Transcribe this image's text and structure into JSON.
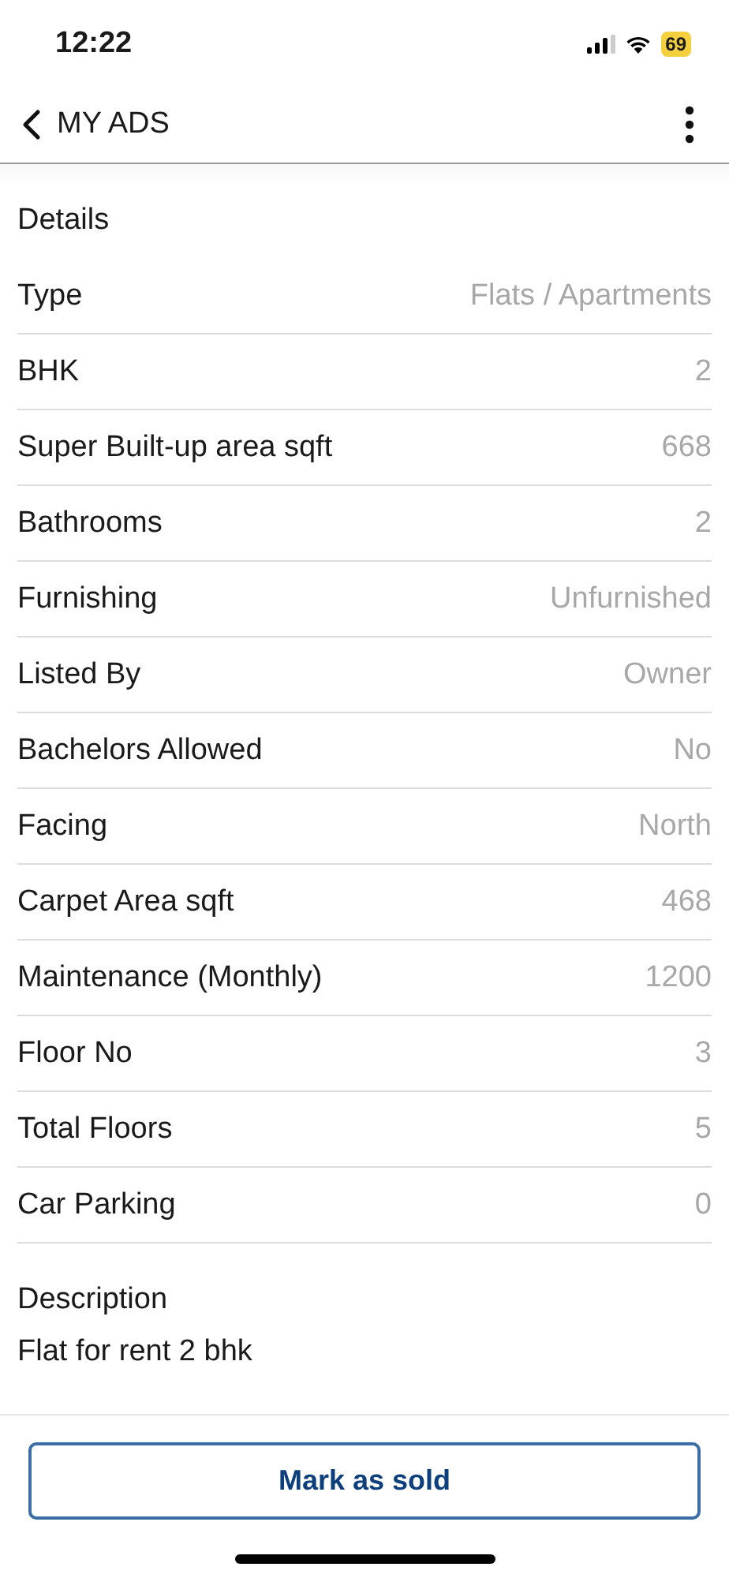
{
  "status_bar": {
    "time": "12:22",
    "battery": "69"
  },
  "header": {
    "title": "MY ADS"
  },
  "details": {
    "heading": "Details",
    "rows": [
      {
        "label": "Type",
        "value": "Flats / Apartments"
      },
      {
        "label": "BHK",
        "value": "2"
      },
      {
        "label": "Super Built-up area sqft",
        "value": "668"
      },
      {
        "label": "Bathrooms",
        "value": "2"
      },
      {
        "label": "Furnishing",
        "value": "Unfurnished"
      },
      {
        "label": "Listed By",
        "value": "Owner"
      },
      {
        "label": "Bachelors Allowed",
        "value": "No"
      },
      {
        "label": "Facing",
        "value": "North"
      },
      {
        "label": "Carpet Area sqft",
        "value": "468"
      },
      {
        "label": "Maintenance (Monthly)",
        "value": "1200"
      },
      {
        "label": "Floor No",
        "value": "3"
      },
      {
        "label": "Total Floors",
        "value": "5"
      },
      {
        "label": "Car Parking",
        "value": "0"
      }
    ]
  },
  "description": {
    "heading": "Description",
    "text": "Flat for rent 2 bhk"
  },
  "footer": {
    "button": "Mark as sold"
  }
}
